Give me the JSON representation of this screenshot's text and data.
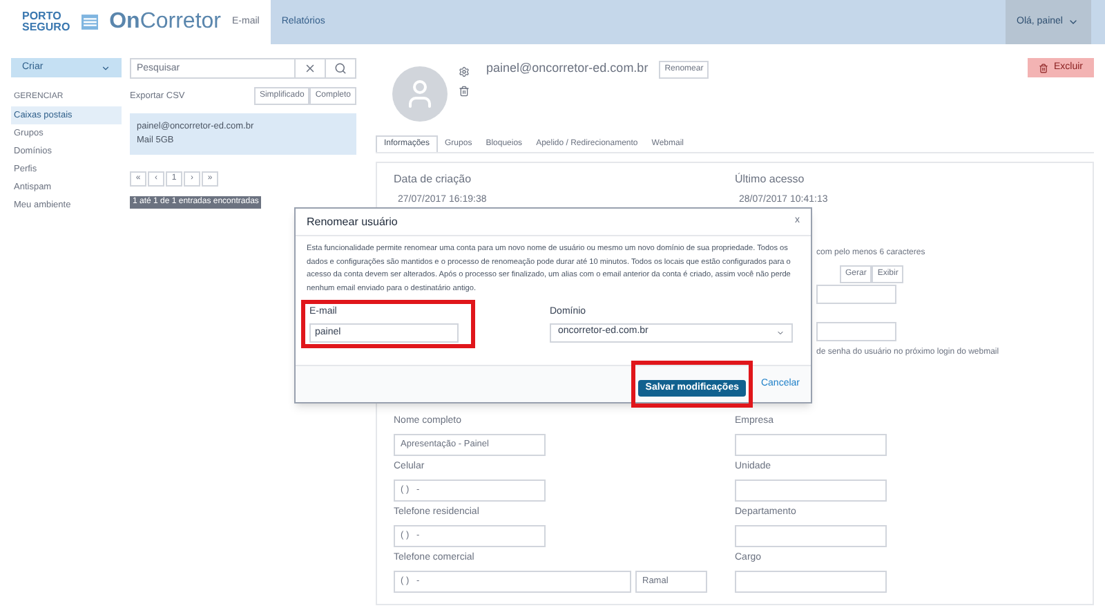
{
  "header": {
    "logo_top": "PORTO",
    "logo_bottom": "SEGURO",
    "app_name_bold": "On",
    "app_name": "Corretor",
    "nav": [
      {
        "label": "E-mail",
        "selected": true
      },
      {
        "label": "Relatórios",
        "selected": false
      }
    ],
    "user": "Olá, painel"
  },
  "sidebar": {
    "create_button": "Criar",
    "heading": "GERENCIAR",
    "items": [
      {
        "label": "Caixas postais",
        "selected": true
      },
      {
        "label": "Grupos",
        "selected": false
      },
      {
        "label": "Domínios",
        "selected": false
      },
      {
        "label": "Perfis",
        "selected": false
      },
      {
        "label": "Antispam",
        "selected": false
      },
      {
        "label": "Meu ambiente",
        "selected": false
      }
    ]
  },
  "list": {
    "search_placeholder": "Pesquisar",
    "export_label": "Exportar CSV",
    "export_buttons": [
      "Simplificado",
      "Completo"
    ],
    "items": [
      {
        "email": "painel@oncorretor-ed.com.br",
        "quota": "Mail 5GB",
        "selected": true
      }
    ],
    "pagination": [
      "«",
      "‹",
      "1",
      "›",
      "»"
    ],
    "count": "1 até 1 de 1 entradas encontradas"
  },
  "account": {
    "email": "painel@oncorretor-ed.com.br",
    "rename_button": "Renomear",
    "delete_button": "Excluir",
    "tabs": [
      {
        "label": "Informações",
        "selected": true
      },
      {
        "label": "Grupos",
        "selected": false
      },
      {
        "label": "Bloqueios",
        "selected": false
      },
      {
        "label": "Apelido / Redirecionamento",
        "selected": false
      },
      {
        "label": "Webmail",
        "selected": false
      }
    ],
    "created_label": "Data de criação",
    "created": "27/07/2017 16:19:38",
    "last_access_label": "Último acesso",
    "last_access": "28/07/2017 10:41:13",
    "password_hint": "com pelo menos 6 caracteres",
    "password_buttons": [
      "Gerar",
      "Exibir"
    ],
    "force_change": "de senha do usuário no próximo login do webmail",
    "left_fields": [
      {
        "label": "Nome completo",
        "value": "Apresentação - Painel"
      },
      {
        "label": "Celular",
        "value": "( )   -"
      },
      {
        "label": "Telefone residencial",
        "value": "( )   -"
      },
      {
        "label": "Telefone comercial",
        "value": "( )   -",
        "extra_placeholder": "Ramal"
      }
    ],
    "right_fields": [
      {
        "label": "Empresa"
      },
      {
        "label": "Unidade"
      },
      {
        "label": "Departamento"
      },
      {
        "label": "Cargo"
      }
    ]
  },
  "dialog": {
    "title": "Renomear usuário",
    "close": "x",
    "description": "Esta funcionalidade permite renomear uma conta para um novo nome de usuário ou mesmo um novo domínio de sua propriedade. Todos os dados e configurações são mantidos e o processo de renomeação pode durar até 10 minutos. Todos os locais que estão configurados para o acesso da conta devem ser alterados. Após o processo ser finalizado, um alias com o email anterior da conta é criado, assim você não perde nenhum email enviado para o destinatário antigo.",
    "email_label": "E-mail",
    "email_value": "painel",
    "email_highlighted": true,
    "domain_label": "Domínio",
    "domain_value": "oncorretor-ed.com.br",
    "save_button": "Salvar modificações",
    "save_highlighted": true,
    "cancel_button": "Cancelar"
  }
}
